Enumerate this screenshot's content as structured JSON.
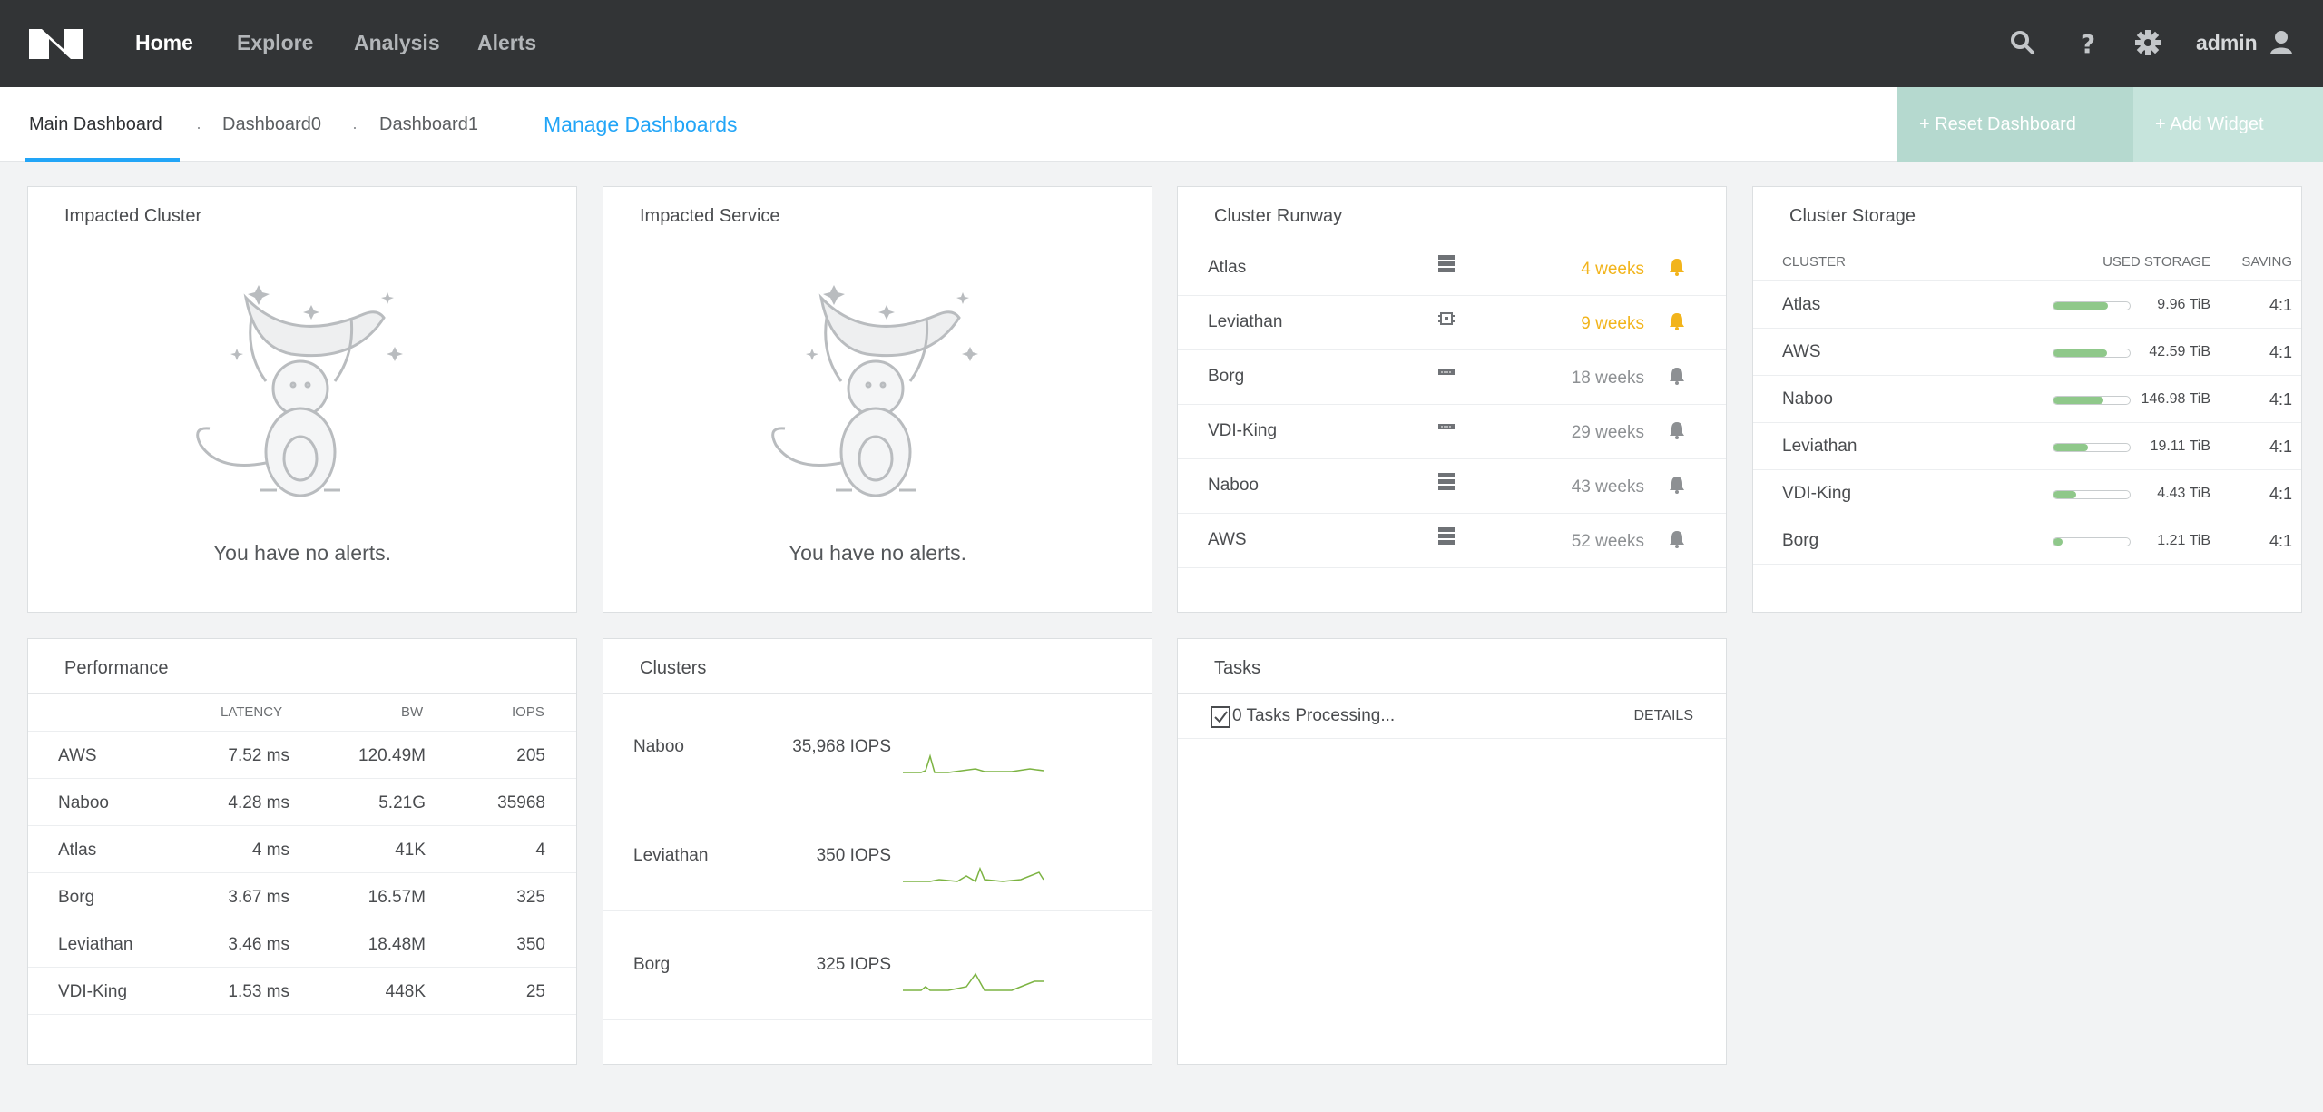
{
  "nav": {
    "logo": "N",
    "items": [
      "Home",
      "Explore",
      "Analysis",
      "Alerts"
    ],
    "user": "admin"
  },
  "tabs": {
    "items": [
      "Main Dashboard",
      "Dashboard0",
      "Dashboard1"
    ],
    "manage": "Manage Dashboards",
    "reset": "+   Reset Dashboard",
    "add": "+   Add Widget"
  },
  "impacted_cluster": {
    "title": "Impacted Cluster",
    "message": "You have no alerts."
  },
  "impacted_service": {
    "title": "Impacted Service",
    "message": "You have no alerts."
  },
  "cluster_runway": {
    "title": "Cluster Runway",
    "rows": [
      {
        "name": "Atlas",
        "weeks": "4 weeks",
        "status": "warning",
        "icon": "server-stack-icon"
      },
      {
        "name": "Leviathan",
        "weeks": "9 weeks",
        "status": "warning",
        "icon": "chip-icon"
      },
      {
        "name": "Borg",
        "weeks": "18 weeks",
        "status": "normal",
        "icon": "rack-icon"
      },
      {
        "name": "VDI-King",
        "weeks": "29 weeks",
        "status": "normal",
        "icon": "rack-icon"
      },
      {
        "name": "Naboo",
        "weeks": "43 weeks",
        "status": "normal",
        "icon": "server-stack-icon"
      },
      {
        "name": "AWS",
        "weeks": "52 weeks",
        "status": "normal",
        "icon": "server-stack-icon"
      }
    ]
  },
  "cluster_storage": {
    "title": "Cluster Storage",
    "headers": {
      "cluster": "CLUSTER",
      "used": "USED STORAGE",
      "saving": "SAVING"
    },
    "rows": [
      {
        "name": "Atlas",
        "used": "9.96 TiB",
        "fill": 0.72,
        "saving": "4:1"
      },
      {
        "name": "AWS",
        "used": "42.59 TiB",
        "fill": 0.7,
        "saving": "4:1"
      },
      {
        "name": "Naboo",
        "used": "146.98 TiB",
        "fill": 0.66,
        "saving": "4:1"
      },
      {
        "name": "Leviathan",
        "used": "19.11 TiB",
        "fill": 0.45,
        "saving": "4:1"
      },
      {
        "name": "VDI-King",
        "used": "4.43 TiB",
        "fill": 0.3,
        "saving": "4:1"
      },
      {
        "name": "Borg",
        "used": "1.21 TiB",
        "fill": 0.12,
        "saving": "4:1"
      }
    ]
  },
  "performance": {
    "title": "Performance",
    "headers": {
      "latency": "LATENCY",
      "bw": "BW",
      "iops": "IOPS"
    },
    "rows": [
      {
        "name": "AWS",
        "latency": "7.52 ms",
        "bw": "120.49M",
        "iops": "205"
      },
      {
        "name": "Naboo",
        "latency": "4.28 ms",
        "bw": "5.21G",
        "iops": "35968"
      },
      {
        "name": "Atlas",
        "latency": "4 ms",
        "bw": "41K",
        "iops": "4"
      },
      {
        "name": "Borg",
        "latency": "3.67 ms",
        "bw": "16.57M",
        "iops": "325"
      },
      {
        "name": "Leviathan",
        "latency": "3.46 ms",
        "bw": "18.48M",
        "iops": "350"
      },
      {
        "name": "VDI-King",
        "latency": "1.53 ms",
        "bw": "448K",
        "iops": "25"
      }
    ]
  },
  "clusters": {
    "title": "Clusters",
    "rows": [
      {
        "name": "Naboo",
        "iops": "35,968 IOPS"
      },
      {
        "name": "Leviathan",
        "iops": "350 IOPS"
      },
      {
        "name": "Borg",
        "iops": "325 IOPS"
      },
      {
        "name": "",
        "iops": ""
      }
    ]
  },
  "tasks": {
    "title": "Tasks",
    "processing": "0 Tasks Processing...",
    "details": "DETAILS"
  },
  "colors": {
    "accent": "#22a5f7",
    "warning": "#f2b41b",
    "spark": "#7cb342",
    "nav_bg": "#323436"
  }
}
